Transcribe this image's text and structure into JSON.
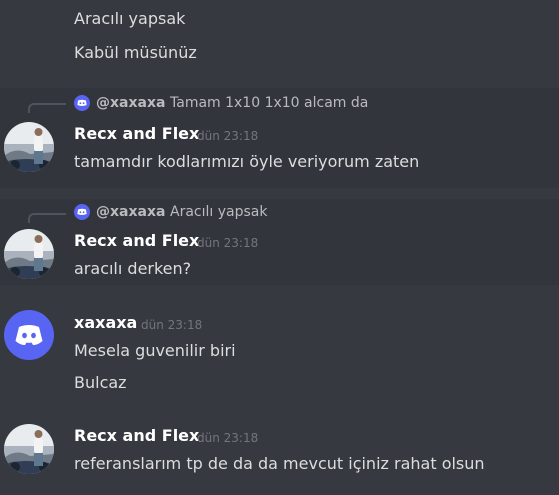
{
  "messages": [
    {
      "text": "Aracılı yapsak"
    },
    {
      "text": "Kabül müsünüz"
    }
  ],
  "group1": {
    "reply": {
      "name": "@xaxaxa",
      "text": "Tamam 1x10 1x10 alcam da"
    },
    "author": "Recx and Flex",
    "timestamp": "dün 23:18",
    "text": "tamamdır kodlarımızı öyle veriyorum zaten"
  },
  "group2": {
    "reply": {
      "name": "@xaxaxa",
      "text": "Aracılı yapsak"
    },
    "author": "Recx and Flex",
    "timestamp": "dün 23:18",
    "text": "aracılı derken?"
  },
  "group3": {
    "author": "xaxaxa",
    "timestamp": "dün 23:18",
    "lines": [
      "Mesela guvenilir biri",
      "Bulcaz"
    ]
  },
  "group4": {
    "author": "Recx and Flex",
    "timestamp": "dün 23:18",
    "text": "referanslarım tp de da da mevcut içiniz rahat olsun"
  },
  "icons": {
    "reply_badge": "discord-logo-icon",
    "avatar_discord": "discord-logo-icon"
  },
  "colors": {
    "background": "#36393f",
    "highlight": "#32353b",
    "blurple": "#5865f2",
    "author": "#ffffff",
    "text": "#dcddde",
    "muted": "#72767d"
  }
}
